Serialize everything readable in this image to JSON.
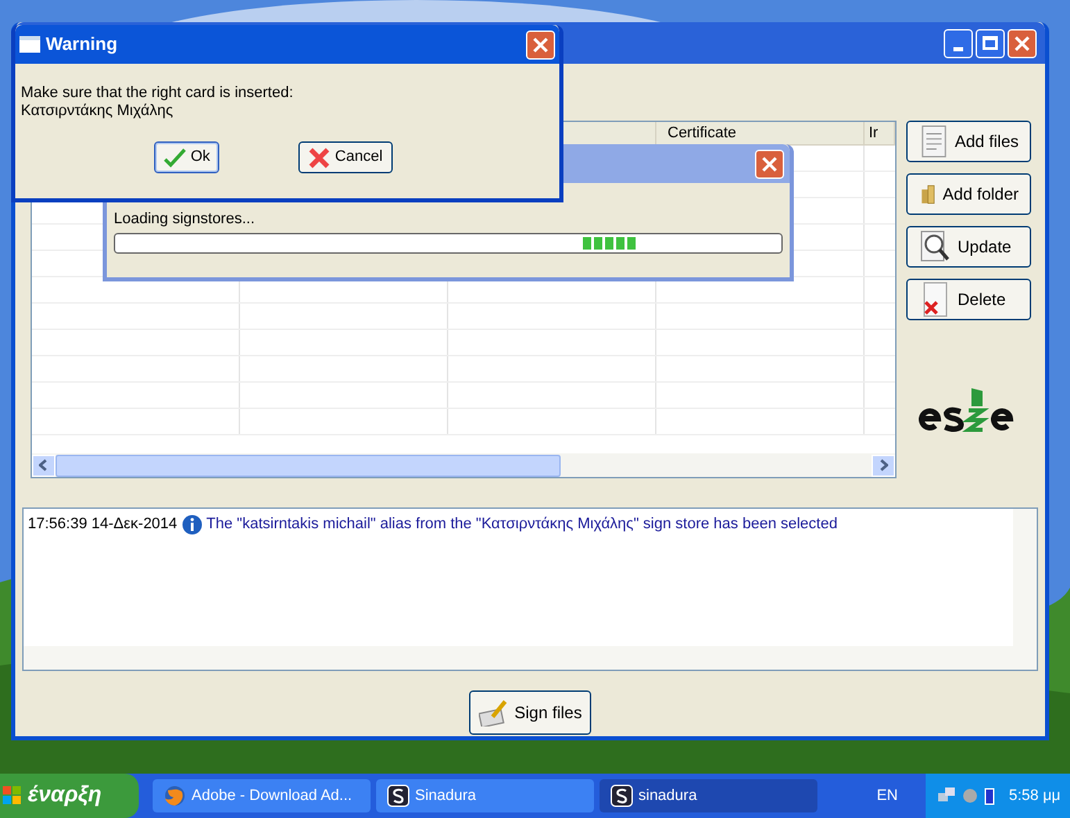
{
  "main_window": {
    "table": {
      "columns": [
        {
          "label": "Certificate"
        },
        {
          "label": "Ir"
        }
      ]
    },
    "buttons": [
      {
        "label": "Add files",
        "kind": "files"
      },
      {
        "label": "Add folder",
        "kind": "folder"
      },
      {
        "label": "Update",
        "kind": "update"
      },
      {
        "label": "Delete",
        "kind": "delete"
      }
    ],
    "log": [
      {
        "time": "17:56:39 14-Δεκ-2014",
        "message": "The \"katsirntakis michail\" alias from the \"Κατσιρντάκης Μιχάλης\" sign store has been selected"
      }
    ],
    "sign_button": "Sign files"
  },
  "loading_dialog": {
    "message": "Loading signstores..."
  },
  "warning_dialog": {
    "title": "Warning",
    "message": "Make sure that the right card is inserted:",
    "card_name": "Κατσιρντάκης Μιχάλης",
    "buttons": [
      {
        "label": "Ok",
        "kind": "ok"
      },
      {
        "label": "Cancel",
        "kind": "cancel"
      }
    ]
  },
  "taskbar": {
    "start": "έναρξη",
    "tasks": [
      {
        "label": "Adobe - Download Ad...",
        "kind": "browser",
        "selected": false
      },
      {
        "label": "Sinadura",
        "kind": "app",
        "selected": false
      },
      {
        "label": "sinadura",
        "kind": "app",
        "selected": true
      }
    ],
    "language": "EN",
    "clock": "5:58 μμ"
  }
}
